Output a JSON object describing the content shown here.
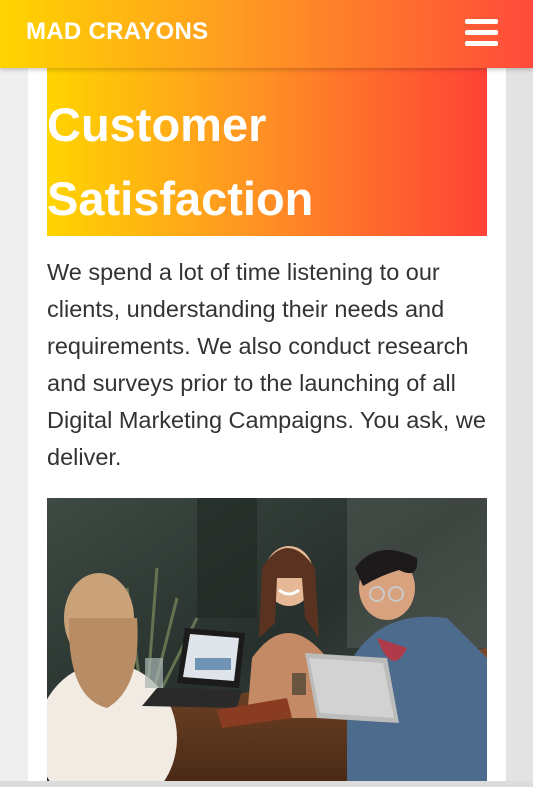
{
  "navbar": {
    "brand": "MAD CRAYONS",
    "menu_icon": "hamburger-menu-icon"
  },
  "hero": {
    "title": "Customer Satisfaction",
    "body": "We spend a lot of time listening to our clients, understanding their needs and requirements. We also conduct research and surveys prior to the launching of all Digital Marketing Campaigns. You ask, we deliver."
  },
  "image": {
    "subject": "three people laughing around a table with laptops"
  },
  "colors": {
    "gradient_start": "#ffd400",
    "gradient_end": "#ff4a3a",
    "text": "#333333"
  }
}
